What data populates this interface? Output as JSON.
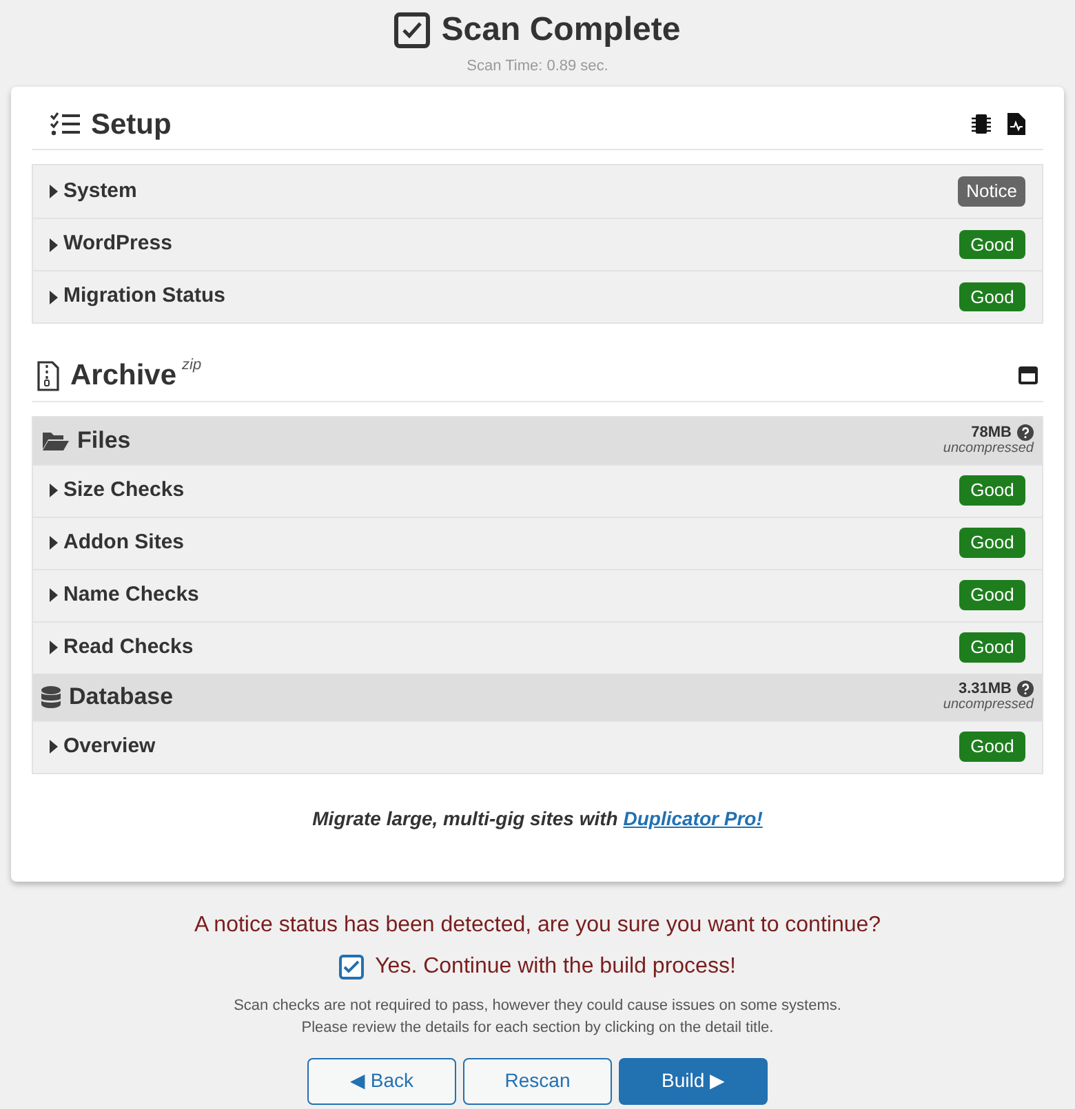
{
  "header": {
    "title": "Scan Complete",
    "checked": true,
    "scan_time": "Scan Time: 0.89 sec."
  },
  "setup": {
    "title": "Setup",
    "rows": [
      {
        "label": "System",
        "status": "Notice",
        "kind": "notice"
      },
      {
        "label": "WordPress",
        "status": "Good",
        "kind": "good"
      },
      {
        "label": "Migration Status",
        "status": "Good",
        "kind": "good"
      }
    ]
  },
  "archive": {
    "title": "Archive",
    "format": "zip",
    "groups": [
      {
        "kind": "files",
        "title": "Files",
        "size": "78MB",
        "size_note": "uncompressed",
        "rows": [
          {
            "label": "Size Checks",
            "status": "Good",
            "kind": "good"
          },
          {
            "label": "Addon Sites",
            "status": "Good",
            "kind": "good"
          },
          {
            "label": "Name Checks",
            "status": "Good",
            "kind": "good"
          },
          {
            "label": "Read Checks",
            "status": "Good",
            "kind": "good"
          }
        ]
      },
      {
        "kind": "database",
        "title": "Database",
        "size": "3.31MB",
        "size_note": "uncompressed",
        "rows": [
          {
            "label": "Overview",
            "status": "Good",
            "kind": "good"
          }
        ]
      }
    ]
  },
  "promo": {
    "text": "Migrate large, multi-gig sites with",
    "link": "Duplicator Pro!"
  },
  "notice": {
    "message": "A notice status has been detected, are you sure you want to continue?",
    "confirm_label": "Yes. Continue with the build process!",
    "confirm_checked": true,
    "help": [
      "Scan checks are not required to pass, however they could cause issues on some systems.",
      "Please review the details for each section by clicking on the detail title."
    ]
  },
  "buttons": [
    {
      "label": "◀ Back",
      "kind": "secondary"
    },
    {
      "label": "Rescan",
      "kind": "secondary"
    },
    {
      "label": "Build ▶",
      "kind": "primary"
    }
  ]
}
